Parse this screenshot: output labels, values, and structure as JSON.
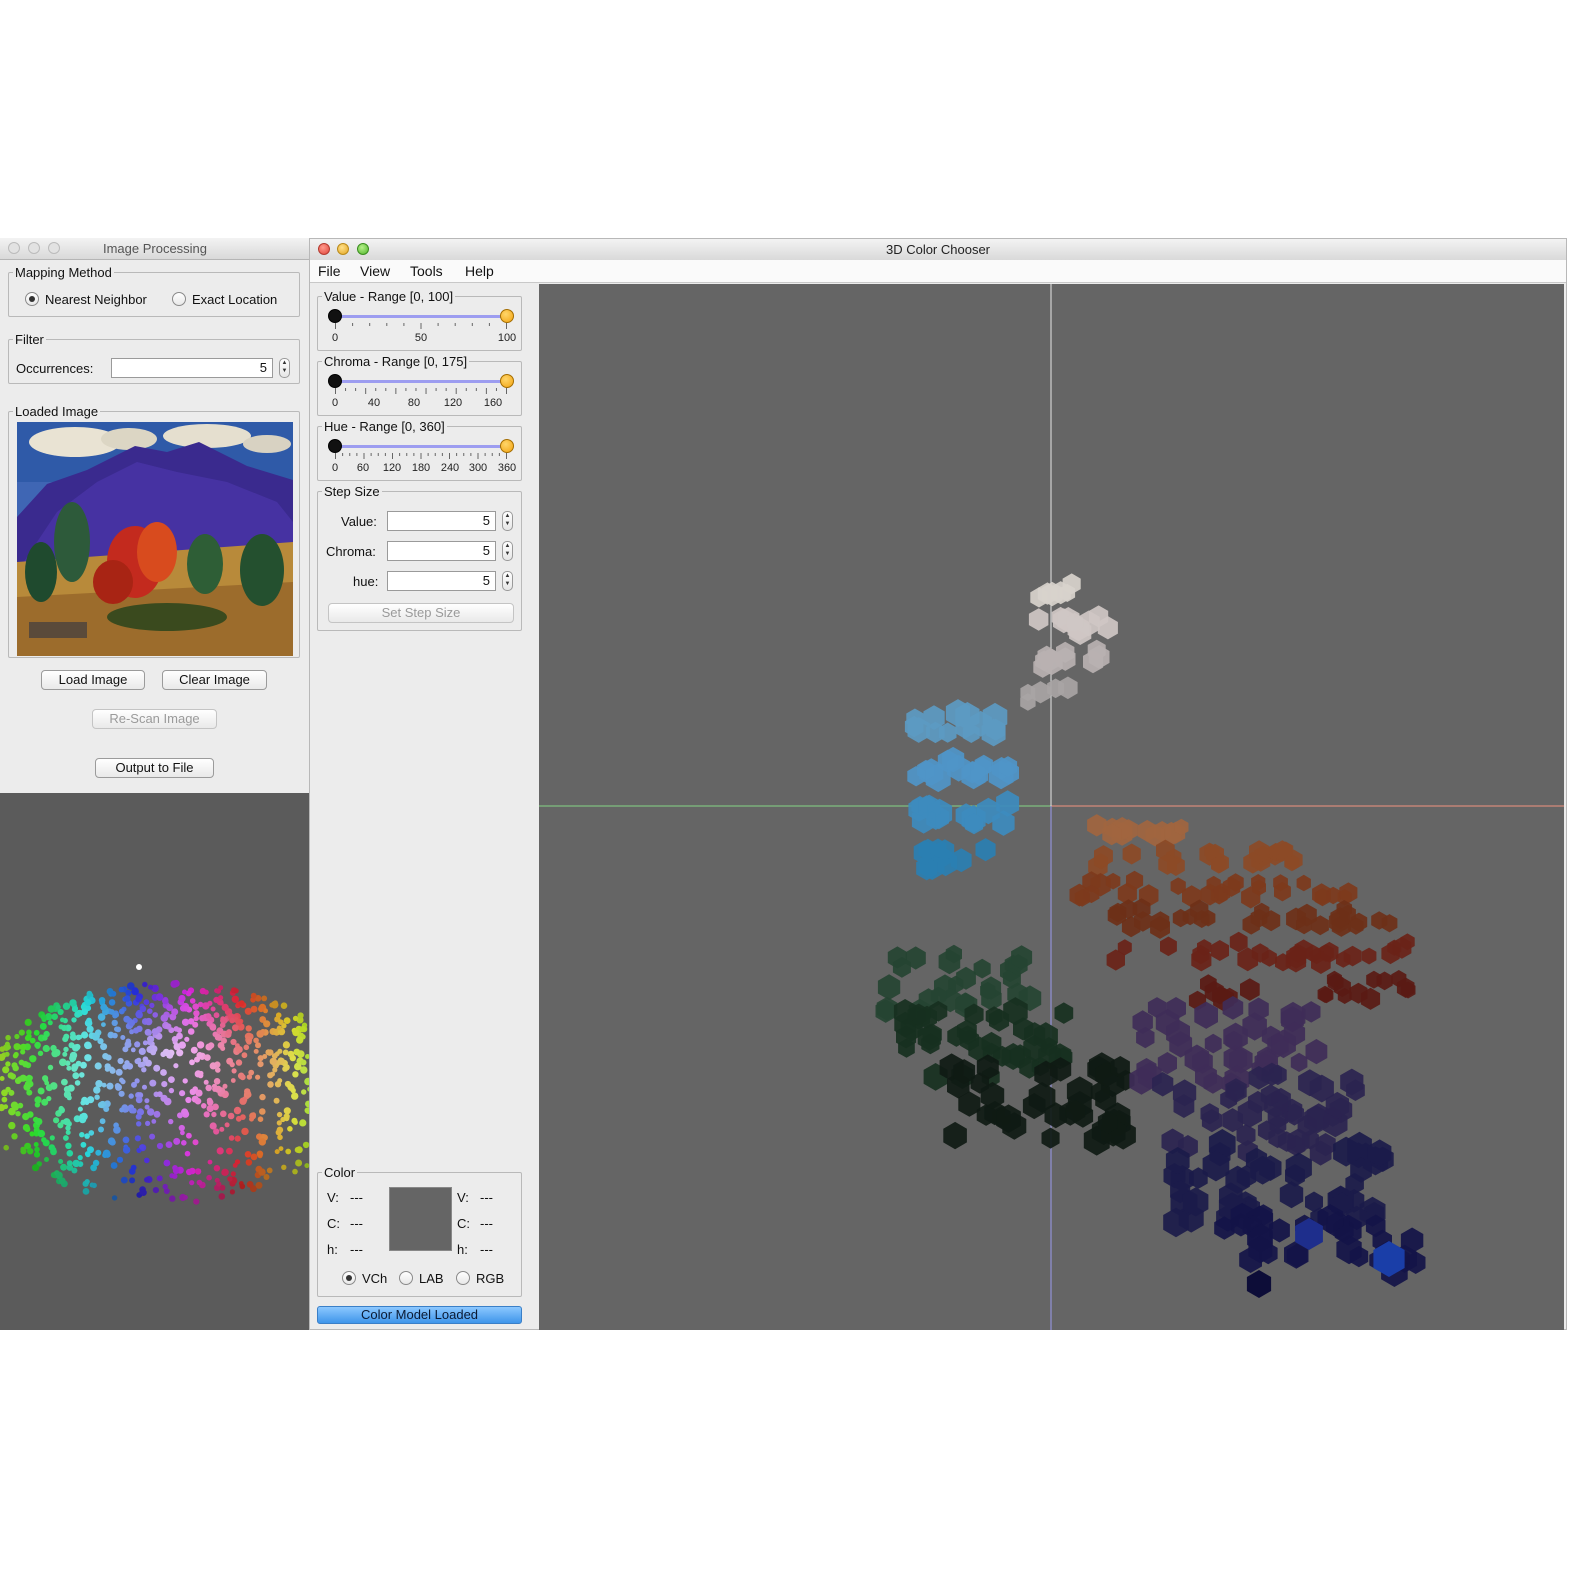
{
  "image_processing": {
    "window_title": "Image Processing",
    "mapping_method": {
      "legend": "Mapping Method",
      "options": [
        "Nearest Neighbor",
        "Exact Location"
      ],
      "selected": "Nearest Neighbor"
    },
    "filter": {
      "legend": "Filter",
      "occurrences_label": "Occurrences:",
      "occurrences_value": "5"
    },
    "loaded_image": {
      "legend": "Loaded Image"
    },
    "buttons": {
      "load": "Load Image",
      "clear": "Clear Image",
      "rescan": "Re-Scan Image",
      "output": "Output to File"
    }
  },
  "color_chooser": {
    "window_title": "3D Color Chooser",
    "menu": [
      "File",
      "View",
      "Tools",
      "Help"
    ],
    "value_range": {
      "legend": "Value - Range [0, 100]",
      "ticks": [
        "0",
        "50",
        "100"
      ],
      "low": 0,
      "high": 100
    },
    "chroma_range": {
      "legend": "Chroma - Range [0, 175]",
      "ticks": [
        "0",
        "40",
        "80",
        "120",
        "160"
      ],
      "low": 0,
      "high": 175
    },
    "hue_range": {
      "legend": "Hue - Range [0, 360]",
      "ticks": [
        "0",
        "60",
        "120",
        "180",
        "240",
        "300",
        "360"
      ],
      "low": 0,
      "high": 360
    },
    "step_size": {
      "legend": "Step Size",
      "value_label": "Value:",
      "value": "5",
      "chroma_label": "Chroma:",
      "chroma": "5",
      "hue_label": "hue:",
      "hue": "5",
      "button": "Set Step Size"
    },
    "color": {
      "legend": "Color",
      "left": {
        "v_label": "V:",
        "v": "---",
        "c_label": "C:",
        "c": "---",
        "h_label": "h:",
        "h": "---"
      },
      "right": {
        "v_label": "V:",
        "v": "---",
        "c_label": "C:",
        "c": "---",
        "h_label": "h:",
        "h": "---"
      },
      "swatch_color": "#656565",
      "models": [
        "VCh",
        "LAB",
        "RGB"
      ],
      "selected_model": "VCh"
    },
    "status": "Color Model Loaded"
  },
  "colors": {
    "viewport_bg": "#656565",
    "status_blue": "#4a9cf0",
    "slider_knob_high": "#f2a311",
    "slider_track": "#9d9df0"
  }
}
